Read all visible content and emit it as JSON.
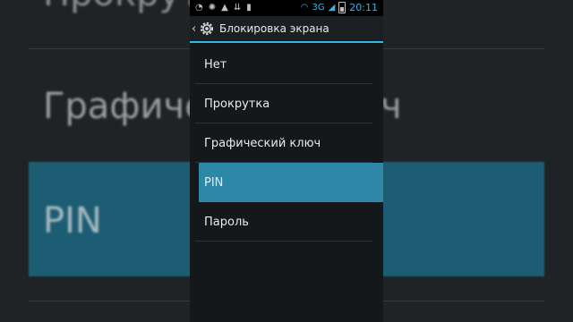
{
  "background": {
    "top_text": "Прокрутка",
    "mid_text": "Графический ключ",
    "pin_text": "PIN"
  },
  "status_bar": {
    "network": "3G",
    "time": "20:11",
    "icons": [
      "sync-icon",
      "usb-debug-icon",
      "warning-icon",
      "download-icon",
      "sd-card-icon",
      "wifi-icon",
      "signal-icon",
      "battery-icon"
    ]
  },
  "action_bar": {
    "title": "Блокировка экрана",
    "back_icon": "chevron-left-icon",
    "settings_icon": "gear-icon"
  },
  "options": [
    {
      "label": "Нет"
    },
    {
      "label": "Прокрутка"
    },
    {
      "label": "Графический ключ"
    },
    {
      "label": "PIN"
    },
    {
      "label": "Пароль"
    }
  ],
  "selected_option": "PIN",
  "colors": {
    "accent": "#33b5e5",
    "selected_bg": "#2d87a6",
    "list_bg": "#15181a"
  }
}
